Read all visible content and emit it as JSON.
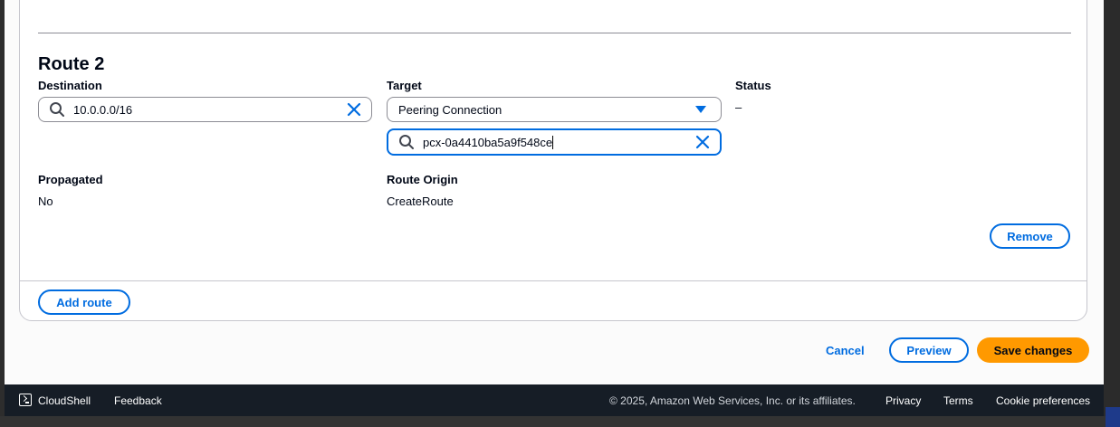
{
  "route": {
    "title": "Route 2",
    "destination": {
      "label": "Destination",
      "value": "10.0.0.0/16"
    },
    "target": {
      "label": "Target",
      "selected": "Peering Connection",
      "search_value": "pcx-0a4410ba5a9f548ce"
    },
    "status": {
      "label": "Status",
      "value": "–"
    },
    "propagated": {
      "label": "Propagated",
      "value": "No"
    },
    "route_origin": {
      "label": "Route Origin",
      "value": "CreateRoute"
    },
    "remove_label": "Remove"
  },
  "panel": {
    "add_route_label": "Add route"
  },
  "actions": {
    "cancel_label": "Cancel",
    "preview_label": "Preview",
    "save_label": "Save changes"
  },
  "footer": {
    "cloudshell_label": "CloudShell",
    "feedback_label": "Feedback",
    "copyright": "© 2025, Amazon Web Services, Inc. or its affiliates.",
    "privacy_label": "Privacy",
    "terms_label": "Terms",
    "cookie_label": "Cookie preferences"
  },
  "colors": {
    "accent": "#006ce0",
    "primary_button": "#ff9900",
    "footer_bg": "#161d26"
  },
  "icons": [
    "search-icon",
    "clear-icon",
    "dropdown-arrow-icon",
    "cloudshell-icon"
  ]
}
